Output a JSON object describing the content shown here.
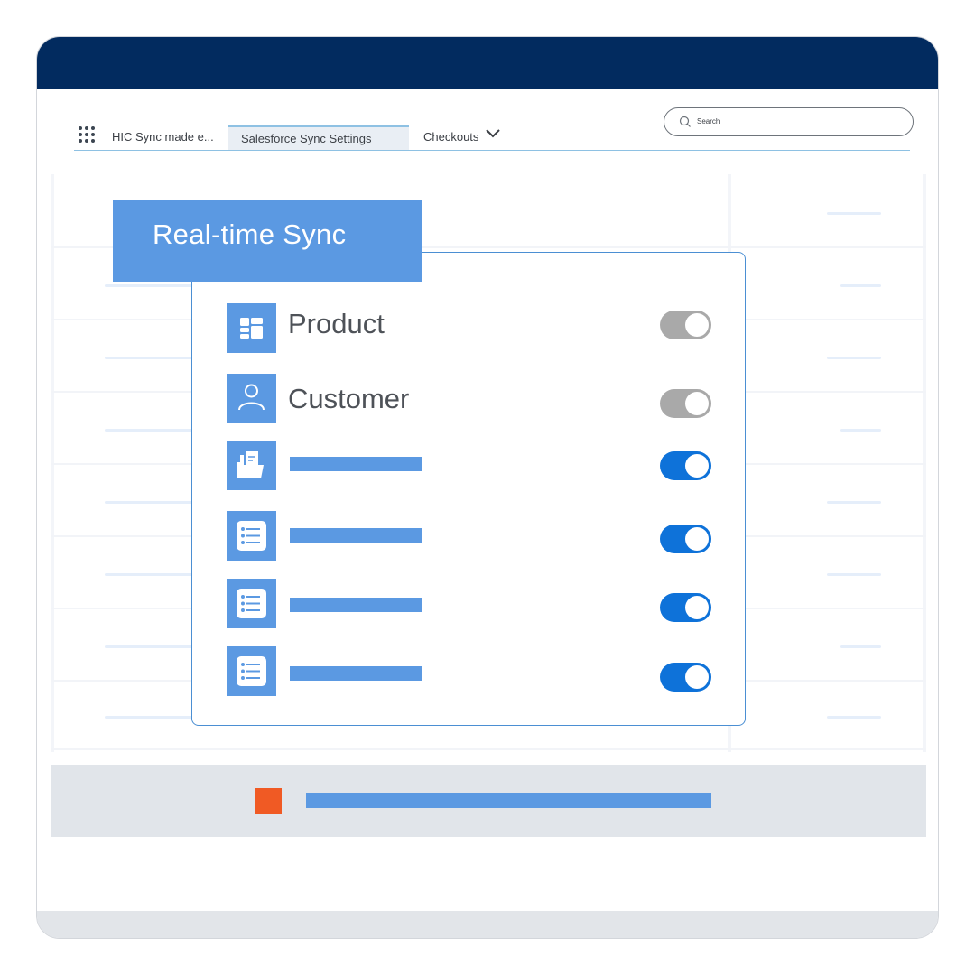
{
  "nav": {
    "app_name": "HIC Sync made e...",
    "tabs": [
      {
        "label": "Salesforce Sync Settings",
        "active": true
      },
      {
        "label": "Checkouts",
        "has_dropdown": true
      }
    ],
    "search_placeholder": "Search"
  },
  "panel": {
    "title": "Real-time Sync",
    "rows": [
      {
        "icon": "product-icon",
        "label": "Product",
        "enabled": false
      },
      {
        "icon": "customer-icon",
        "label": "Customer",
        "enabled": false
      },
      {
        "icon": "folder-icon",
        "label": "",
        "enabled": true
      },
      {
        "icon": "list-icon",
        "label": "",
        "enabled": true
      },
      {
        "icon": "list-icon",
        "label": "",
        "enabled": true
      },
      {
        "icon": "list-icon",
        "label": "",
        "enabled": true
      }
    ]
  },
  "colors": {
    "titlebar": "#022b5f",
    "accent": "#5b99e2",
    "toggle_on": "#0e72d9",
    "toggle_off": "#a9a9a9",
    "alert": "#f05a24"
  }
}
